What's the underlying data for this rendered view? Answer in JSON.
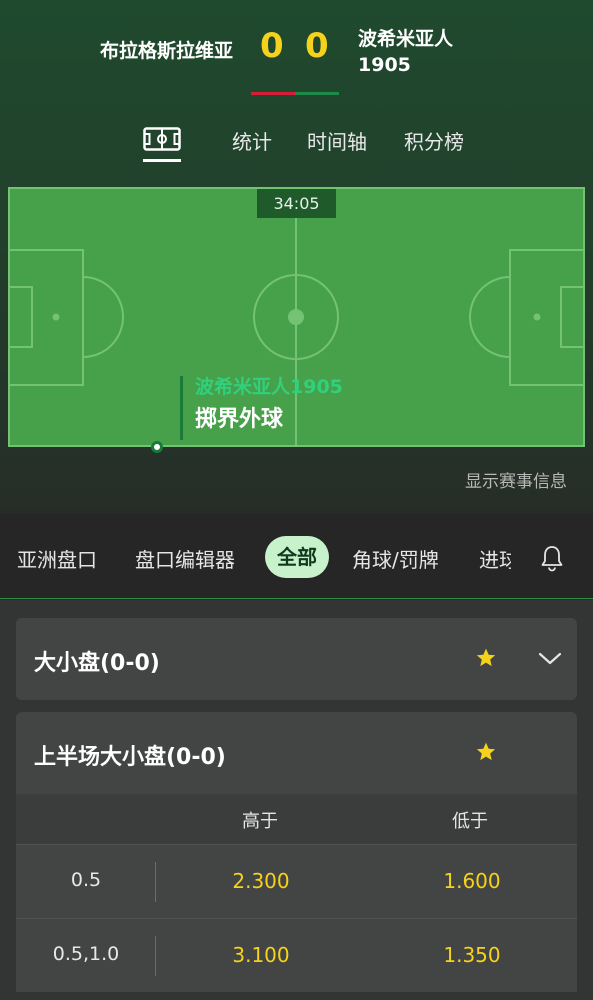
{
  "match": {
    "home_team": "布拉格斯拉维亚",
    "away_team": "波希米亚人\n1905",
    "home_score": "0",
    "away_score": "0",
    "home_color": "#d51d3a",
    "away_color": "#1d8a4a"
  },
  "tabs": {
    "field_icon": "pitch-icon",
    "stats": "统计",
    "timeline": "时间轴",
    "standings": "积分榜"
  },
  "pitch": {
    "clock": "34:05",
    "event_team": "波希米亚人1905",
    "event_action": "掷界外球"
  },
  "show_info": "显示赛事信息",
  "filters": {
    "items": [
      "亚洲盘口",
      "盘口编辑器",
      "全部",
      "角球/罚牌",
      "进球"
    ],
    "active": "全部",
    "bell_icon": "bell-icon"
  },
  "markets": [
    {
      "title": "大小盘(0-0)",
      "starred": true,
      "expanded": false
    },
    {
      "title": "上半场大小盘(0-0)",
      "starred": true,
      "expanded": true,
      "columns": [
        "高于",
        "低于"
      ],
      "rows": [
        {
          "line": "0.5",
          "over": "2.300",
          "under": "1.600"
        },
        {
          "line": "0.5,1.0",
          "over": "3.100",
          "under": "1.350"
        }
      ]
    }
  ]
}
